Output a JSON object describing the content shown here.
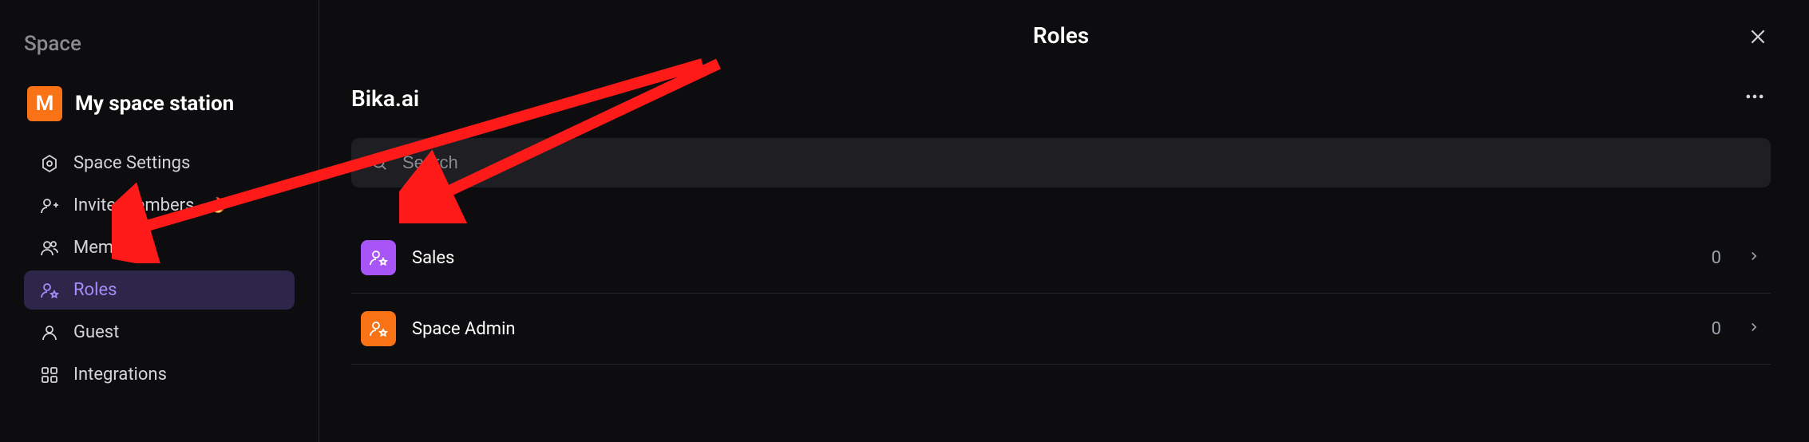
{
  "sidebar": {
    "heading": "Space",
    "workspace": {
      "badge_letter": "M",
      "name": "My space station"
    },
    "items": [
      {
        "label": "Space Settings",
        "icon": "settings-gear-icon",
        "active": false,
        "fire": false
      },
      {
        "label": "Invite Members",
        "icon": "user-plus-icon",
        "active": false,
        "fire": true
      },
      {
        "label": "Members",
        "icon": "users-icon",
        "active": false,
        "fire": false
      },
      {
        "label": "Roles",
        "icon": "user-star-icon",
        "active": true,
        "fire": false
      },
      {
        "label": "Guest",
        "icon": "user-icon",
        "active": false,
        "fire": false
      },
      {
        "label": "Integrations",
        "icon": "grid-icon",
        "active": false,
        "fire": false
      }
    ]
  },
  "main": {
    "title": "Roles",
    "section_title": "Bika.ai",
    "search_placeholder": "Search",
    "roles": [
      {
        "name": "Sales",
        "count": "0",
        "color": "purple"
      },
      {
        "name": "Space Admin",
        "count": "0",
        "color": "orange"
      }
    ]
  },
  "emoji": {
    "fire": "🔥"
  }
}
